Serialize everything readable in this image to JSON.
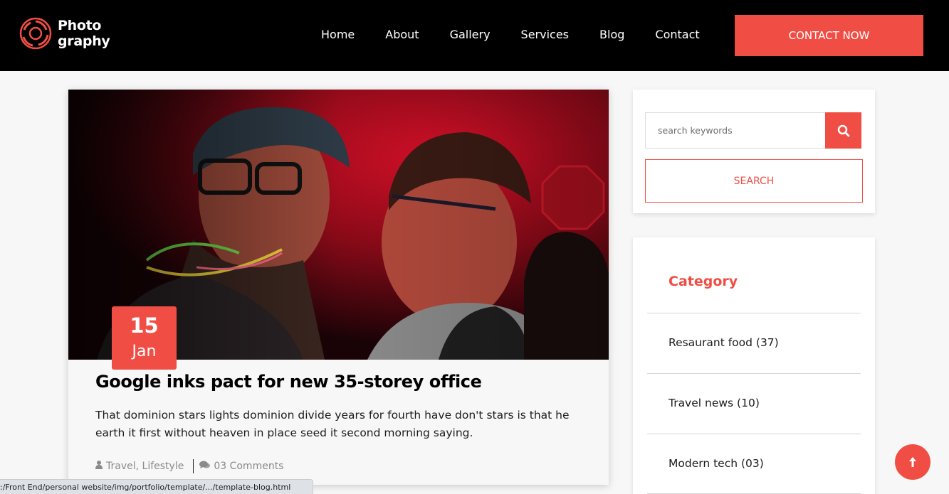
{
  "header": {
    "logo_line1": "Photo",
    "logo_line2": "graphy",
    "nav": [
      "Home",
      "About",
      "Gallery",
      "Services",
      "Blog",
      "Contact"
    ],
    "cta_label": "CONTACT NOW"
  },
  "post": {
    "image_icon": "party-photo",
    "date_day": "15",
    "date_month": "Jan",
    "title": "Google inks pact for new 35-storey office",
    "excerpt": "That dominion stars lights dominion divide years for fourth have don't stars is that he earth it first without heaven in place seed it second morning saying.",
    "tags": "Travel, Lifestyle",
    "comments": "03 Comments"
  },
  "sidebar": {
    "search": {
      "placeholder": "search keywords",
      "button_label": "SEARCH"
    },
    "category": {
      "title": "Category",
      "items": [
        "Resaurant food (37)",
        "Travel news (10)",
        "Modern tech (03)"
      ]
    }
  },
  "statusbar": {
    "url": ":/Front End/personal website/img/portfolio/template/.../template-blog.html"
  },
  "colors": {
    "accent": "#f04e45",
    "header_bg": "#000000",
    "page_bg": "#f7f7f7"
  }
}
